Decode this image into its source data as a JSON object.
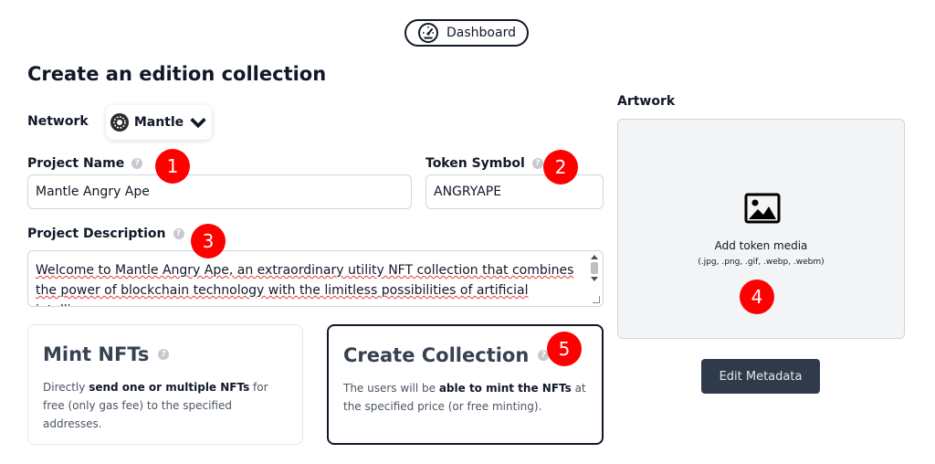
{
  "header": {
    "dashboard_label": "Dashboard"
  },
  "page": {
    "title": "Create an edition collection"
  },
  "network": {
    "label": "Network",
    "selected": "Mantle"
  },
  "form": {
    "project_name_label": "Project Name",
    "project_name_value": "Mantle Angry Ape",
    "token_symbol_label": "Token Symbol",
    "token_symbol_value": "ANGRYAPE",
    "description_label": "Project Description",
    "description_value": "Welcome to Mantle Angry Ape, an extraordinary utility NFT collection that combines the power of blockchain technology with the limitless possibilities of artificial intelligence."
  },
  "cards": {
    "mint": {
      "title": "Mint NFTs",
      "desc_pre": "Directly ",
      "desc_bold": "send one or multiple NFTs",
      "desc_post": " for free (only gas fee) to the specified addresses."
    },
    "create": {
      "title": "Create Collection",
      "desc_pre": "The users will be ",
      "desc_bold": "able to mint the NFTs",
      "desc_post": " at the specified price (or free minting)."
    }
  },
  "artwork": {
    "label": "Artwork",
    "add_text": "Add token media",
    "formats": "(.jpg, .png, .gif, .webp, .webm)"
  },
  "edit_metadata_label": "Edit Metadata",
  "help_glyph": "?",
  "markers": [
    "1",
    "2",
    "3",
    "4",
    "5"
  ],
  "colors": {
    "marker": "#ff0000",
    "button_dark": "#2f3b4b",
    "border": "#d1d5db"
  },
  "icons": [
    "dashboard-icon",
    "mantle-logo-icon",
    "chevron-down-icon",
    "help-icon",
    "image-icon"
  ]
}
